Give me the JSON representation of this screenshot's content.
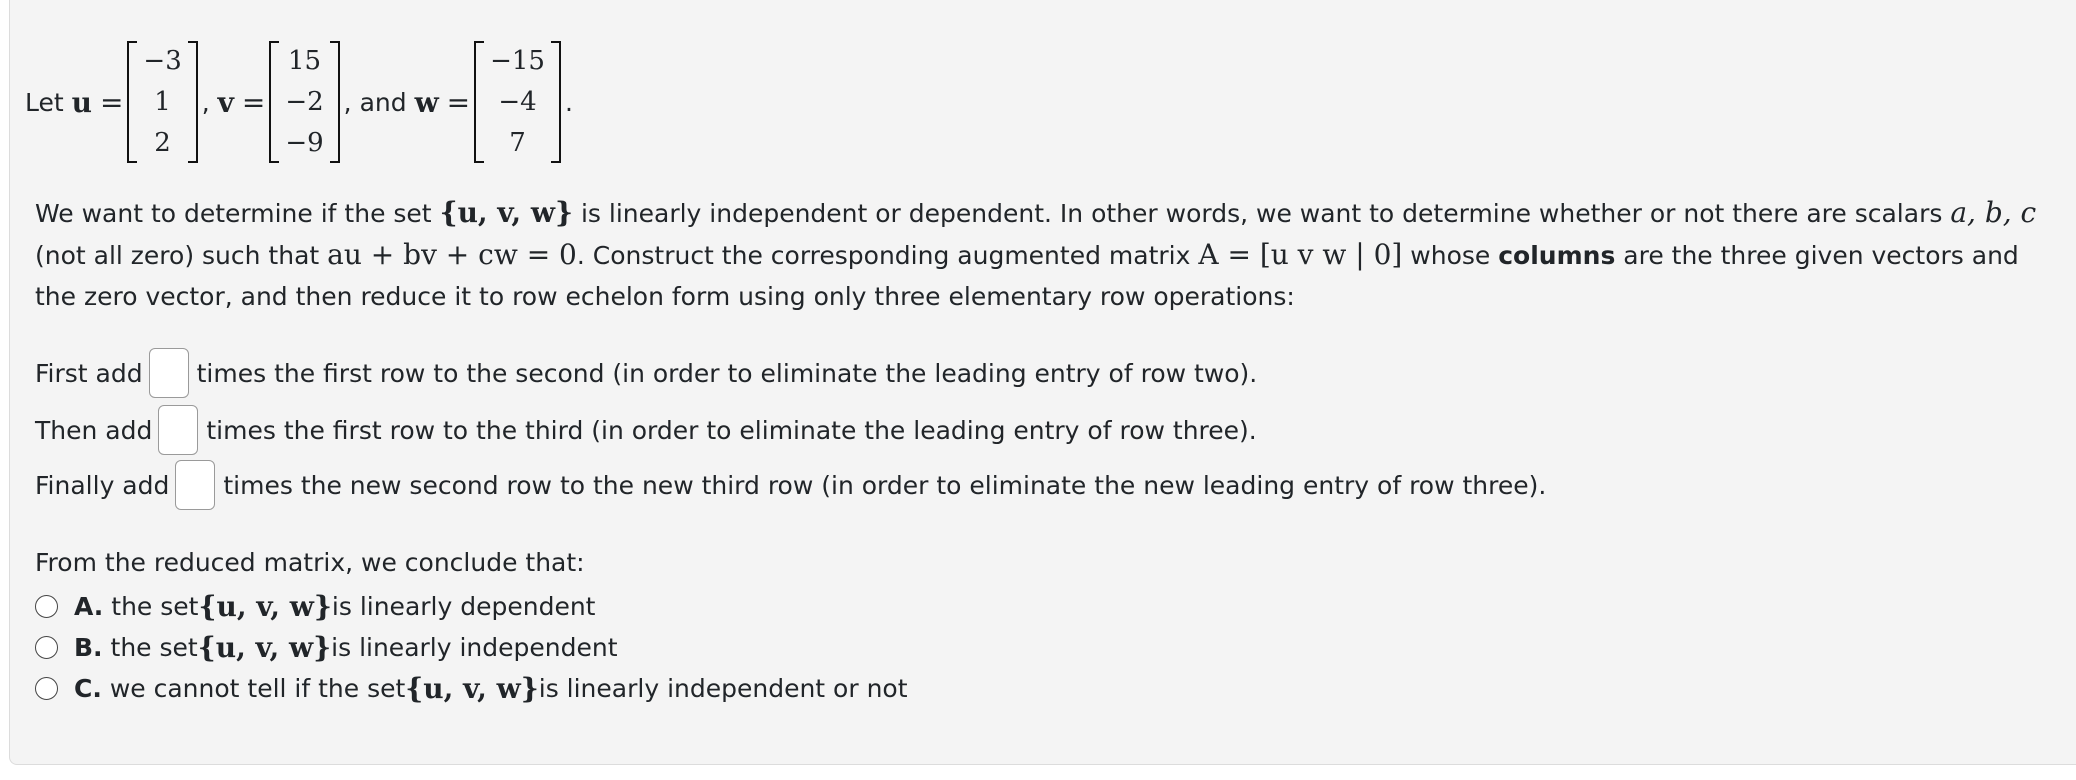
{
  "definition": {
    "let": "Let",
    "u_sym": "u",
    "eq": "=",
    "u_entries": [
      "−3",
      "1",
      "2"
    ],
    "comma1": ",",
    "v_sym": "v",
    "v_entries": [
      "15",
      "−2",
      "−9"
    ],
    "comma_and": ", and",
    "w_sym": "w",
    "w_entries": [
      "−15",
      "−4",
      "7"
    ],
    "period": "."
  },
  "paragraph": {
    "p1": "We want to determine if the set ",
    "set": "{u, v, w}",
    "p2": " is linearly independent or dependent. In other words, we want to determine whether or not there are scalars ",
    "scalars": "a, b, c",
    "p3": " (not all zero) such that ",
    "equation": "au + bv + cw = 0",
    "p4": ". Construct the corresponding augmented matrix ",
    "matrix": "A = [u v w | 0]",
    "p5": " whose ",
    "columns": "columns",
    "p6": " are the three given vectors and the zero vector, and then reduce it to row echelon form using only three elementary row operations:"
  },
  "steps": [
    {
      "prefix": "First add",
      "suffix": "times the first row to the second (in order to eliminate the leading entry of row two).",
      "value": ""
    },
    {
      "prefix": "Then add",
      "suffix": "times the first row to the third (in order to eliminate the leading entry of row three).",
      "value": ""
    },
    {
      "prefix": "Finally add",
      "suffix": "times the new second row to the new third row (in order to eliminate the new leading entry of row three).",
      "value": ""
    }
  ],
  "conclusion": {
    "lead": "From the reduced matrix, we conclude that:",
    "options": [
      {
        "letter": "A.",
        "pre": "the set ",
        "set": "{u, v, w}",
        "post": " is linearly dependent"
      },
      {
        "letter": "B.",
        "pre": "the set ",
        "set": "{u, v, w}",
        "post": " is linearly independent"
      },
      {
        "letter": "C.",
        "pre": "we cannot tell if the set ",
        "set": "{u, v, w}",
        "post": " is linearly independent or not"
      }
    ]
  }
}
